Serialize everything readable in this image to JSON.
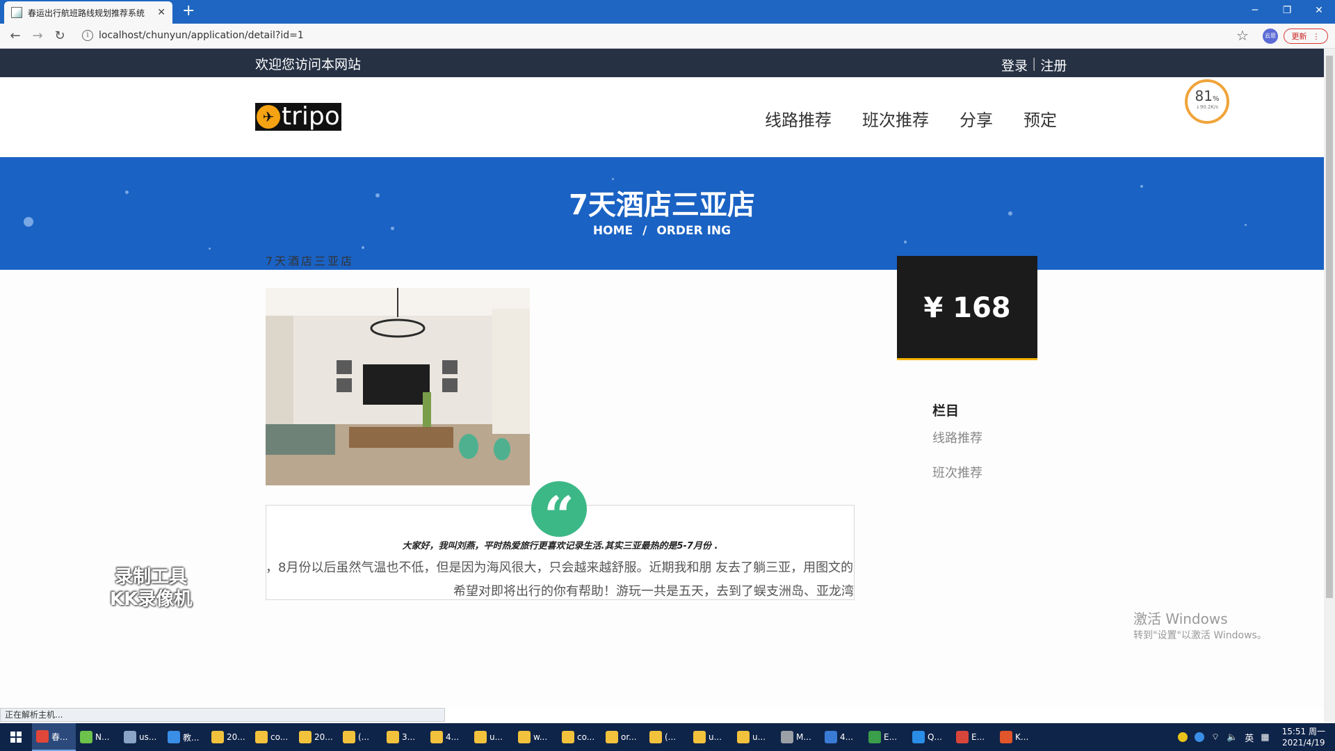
{
  "browser": {
    "tab_title": "春运出行航班路线规划推荐系统",
    "url": "localhost/chunyun/application/detail?id=1",
    "profile_label": "云思",
    "update_label": "更新"
  },
  "site": {
    "welcome": "欢迎您访问本网站",
    "login": "登录",
    "register": "注册",
    "logo_text": "tripo",
    "nav": [
      "线路推荐",
      "班次推荐",
      "分享",
      "预定"
    ],
    "speed_percent": "81",
    "speed_unit": "%",
    "speed_rate": "↓90.2K/s"
  },
  "banner": {
    "title": "7天酒店三亚店",
    "crumb_home": "HOME",
    "crumb_sep": "/",
    "crumb_current": "ORDER ING"
  },
  "detail": {
    "name": "7天酒店三亚店",
    "quote": "大家好，我叫刘燕，平时热爱旅行更喜欢记录生活.其实三亚最热的是5-7月份 .",
    "article_line1": "，8月份以后虽然气温也不低，但是因为海风很大，只会越来越舒服。近期我和朋 友去了躺三亚，用图文的",
    "article_line2": "希望对即将出行的你有帮助！游玩一共是五天，去到了蜈支洲岛、亚龙湾",
    "price": "¥ 168"
  },
  "sidebar": {
    "title": "栏目",
    "links": [
      "线路推荐",
      "班次推荐"
    ]
  },
  "overlays": {
    "watermark_line1": "录制工具",
    "watermark_line2": "KK录像机",
    "activate_title": "激活 Windows",
    "activate_sub": "转到\"设置\"以激活 Windows。",
    "status": "正在解析主机..."
  },
  "taskbar": {
    "items": [
      {
        "label": "春...",
        "color": "#e0463a"
      },
      {
        "label": "N...",
        "color": "#6cc24a"
      },
      {
        "label": "us...",
        "color": "#8aa4c8"
      },
      {
        "label": "教...",
        "color": "#3a8ee6"
      },
      {
        "label": "20...",
        "color": "#f2c23c"
      },
      {
        "label": "co...",
        "color": "#f2c23c"
      },
      {
        "label": "20...",
        "color": "#f2c23c"
      },
      {
        "label": "(...",
        "color": "#f2c23c"
      },
      {
        "label": "3...",
        "color": "#f2c23c"
      },
      {
        "label": "4...",
        "color": "#f2c23c"
      },
      {
        "label": "u...",
        "color": "#f2c23c"
      },
      {
        "label": "w...",
        "color": "#f2c23c"
      },
      {
        "label": "co...",
        "color": "#f2c23c"
      },
      {
        "label": "or...",
        "color": "#f2c23c"
      },
      {
        "label": "(...",
        "color": "#f2c23c"
      },
      {
        "label": "u...",
        "color": "#f2c23c"
      },
      {
        "label": "u...",
        "color": "#f2c23c"
      },
      {
        "label": "M...",
        "color": "#9aa0a6"
      },
      {
        "label": "4...",
        "color": "#3a7bd5"
      },
      {
        "label": "E...",
        "color": "#3a9e4a"
      },
      {
        "label": "Q...",
        "color": "#2a8ee6"
      },
      {
        "label": "E...",
        "color": "#d8453a"
      },
      {
        "label": "K...",
        "color": "#e0552a"
      }
    ],
    "ime": "英",
    "time": "15:51 周一",
    "date": "2021/4/19"
  },
  "colors": {
    "banner": "#1a62c4",
    "top_strip": "#263144",
    "price_accent": "#f5b300",
    "quote_icon": "#3cb887"
  }
}
